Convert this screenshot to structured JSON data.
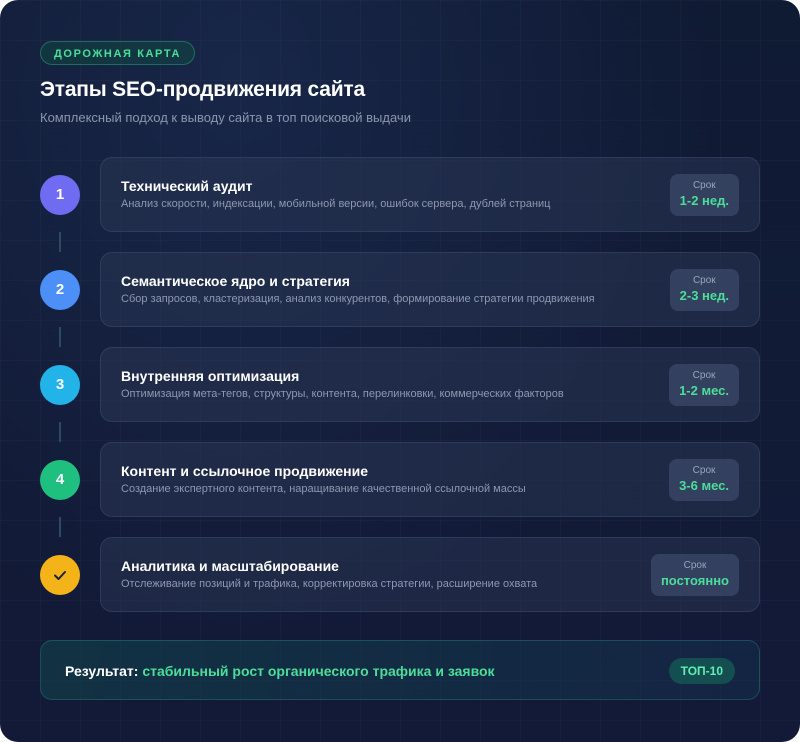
{
  "header": {
    "badge": "ДОРОЖНАЯ КАРТА",
    "title": "Этапы SEO-продвижения сайта",
    "subtitle": "Комплексный подход к выводу сайта в топ поисковой выдачи"
  },
  "term_label": "Срок",
  "steps": [
    {
      "number": "1",
      "title": "Технический аудит",
      "description": "Анализ скорости, индексации, мобильной версии, ошибок сервера, дублей страниц",
      "term": "1-2 нед.",
      "color": "#6f6cf2"
    },
    {
      "number": "2",
      "title": "Семантическое ядро и стратегия",
      "description": "Сбор запросов, кластеризация, анализ конкурентов, формирование стратегии продвижения",
      "term": "2-3 нед.",
      "color": "#4b8ff7"
    },
    {
      "number": "3",
      "title": "Внутренняя оптимизация",
      "description": "Оптимизация мета-тегов, структуры, контента, перелинковки, коммерческих факторов",
      "term": "1-2 мес.",
      "color": "#22b3e8"
    },
    {
      "number": "4",
      "title": "Контент и ссылочное продвижение",
      "description": "Создание экспертного контента, наращивание качественной ссылочной массы",
      "term": "3-6 мес.",
      "color": "#1fbf80"
    },
    {
      "number": "",
      "icon": "check-icon",
      "title": "Аналитика и масштабирование",
      "description": "Отслеживание позиций и трафика, корректировка стратегии, расширение охвата",
      "term": "постоянно",
      "color": "#f5b31a"
    }
  ],
  "result": {
    "label": "Результат:",
    "value": "стабильный рост органического трафика и заявок",
    "tag": "ТОП-10"
  },
  "colors": {
    "accent": "#4ade9a",
    "background": "#111b36"
  }
}
